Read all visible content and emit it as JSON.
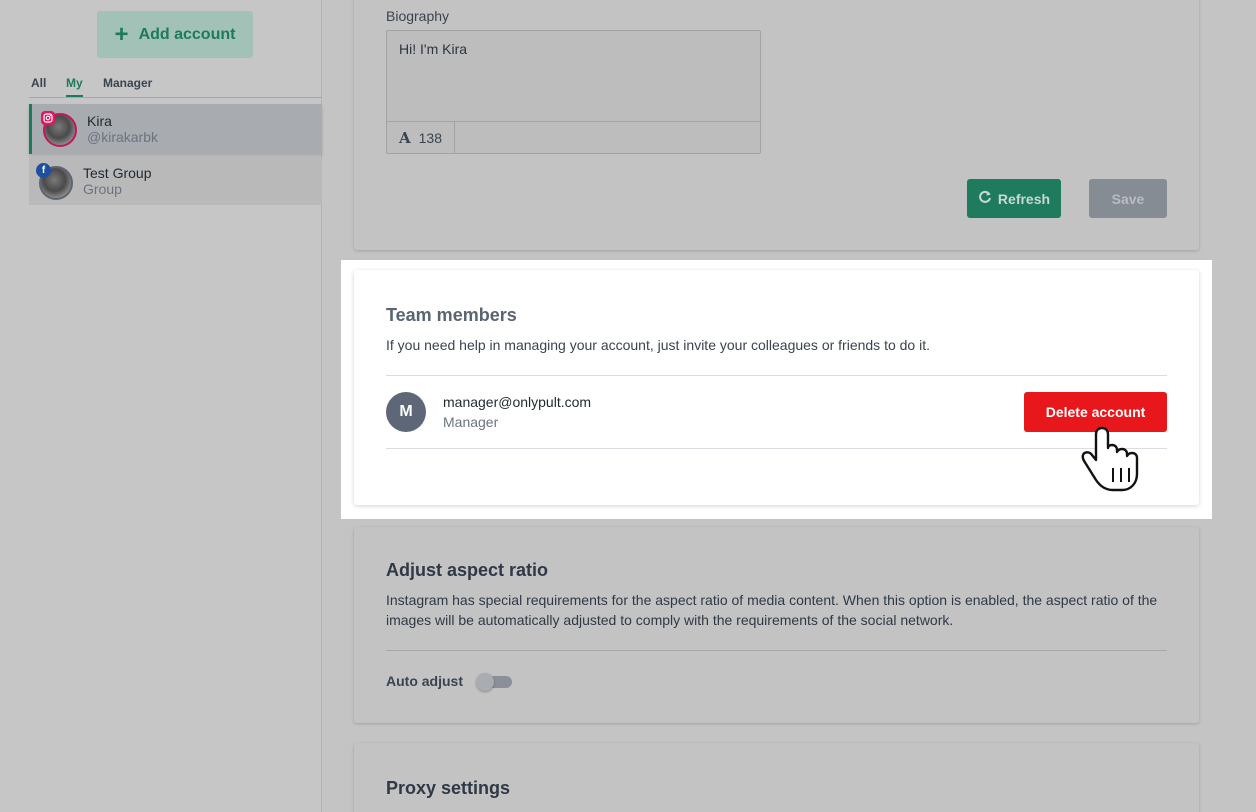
{
  "sidebar": {
    "add_account_label": "Add account",
    "tabs": [
      {
        "label": "All",
        "active": false
      },
      {
        "label": "My",
        "active": true
      },
      {
        "label": "Manager",
        "active": false
      }
    ],
    "accounts": [
      {
        "name": "Kira",
        "handle": "@kirakarbk",
        "network": "instagram-icon",
        "selected": true
      },
      {
        "name": "Test Group",
        "handle": "Group",
        "network": "facebook-icon",
        "selected": false
      }
    ]
  },
  "profile": {
    "biography_label": "Biography",
    "biography_value": "Hi! I'm Kira",
    "char_count": "138",
    "refresh_label": "Refresh",
    "save_label": "Save"
  },
  "team": {
    "title": "Team members",
    "description": "If you need help in managing your account, just invite your colleagues or friends to do it.",
    "members": [
      {
        "initial": "M",
        "email": "manager@onlypult.com",
        "role": "Manager"
      }
    ],
    "delete_label": "Delete account"
  },
  "aspect": {
    "title": "Adjust aspect ratio",
    "description": "Instagram has special requirements for the aspect ratio of media content. When this option is enabled, the aspect ratio of the images will be automatically adjusted to comply with the requirements of the social network.",
    "toggle_label": "Auto adjust",
    "toggle_on": false
  },
  "proxy": {
    "title": "Proxy settings"
  },
  "colors": {
    "accent": "#1d7a5c",
    "danger": "#e8171b",
    "instagram": "#d81b60",
    "facebook": "#1e4fa3"
  }
}
